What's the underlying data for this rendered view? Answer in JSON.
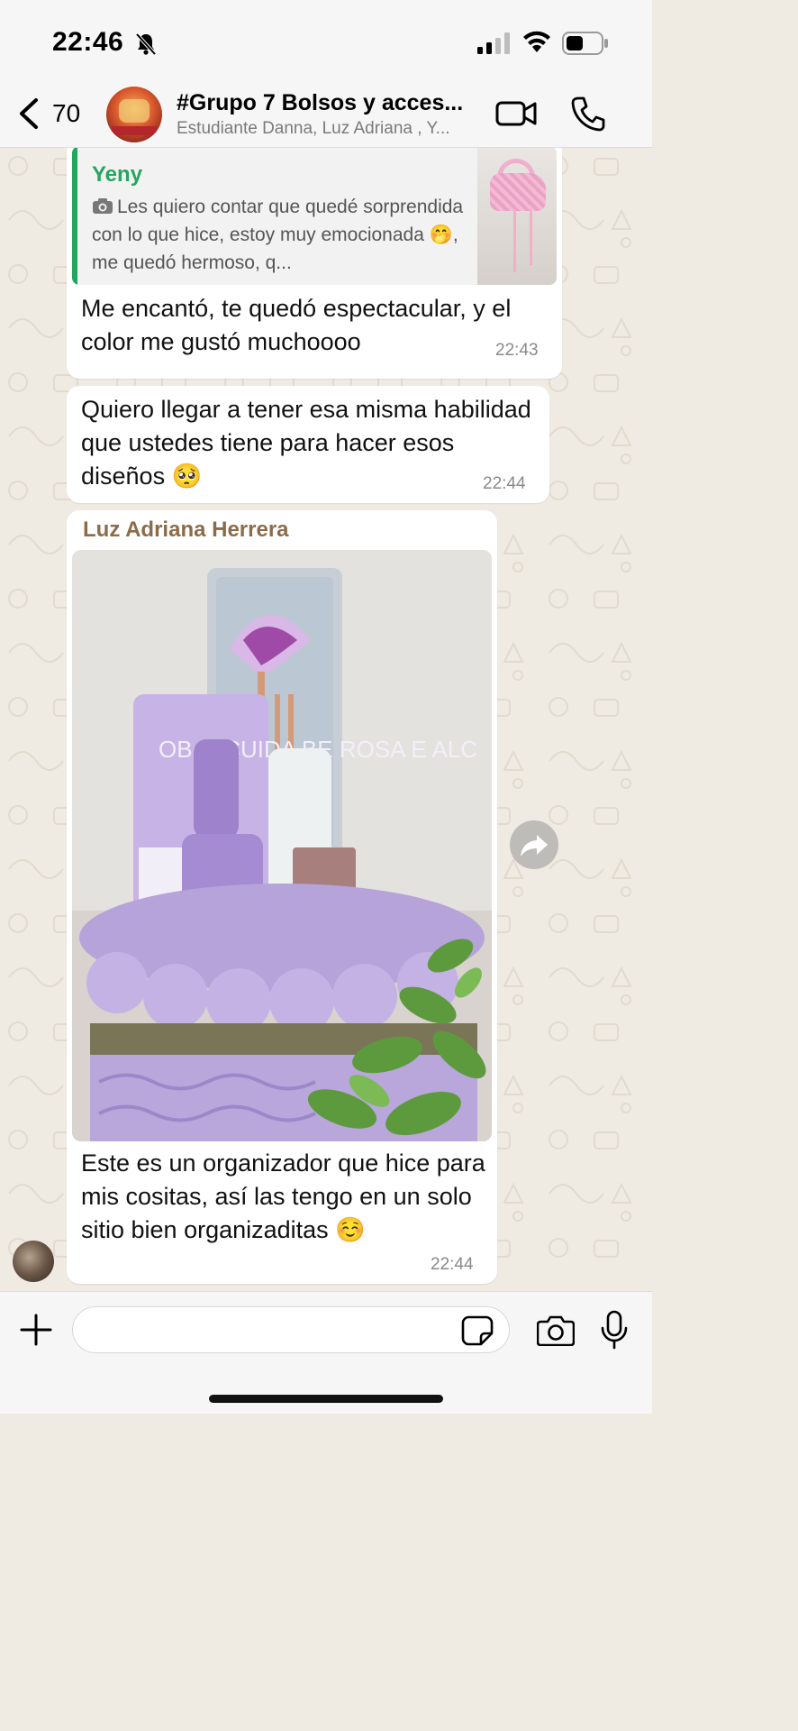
{
  "status_bar": {
    "time": "22:46"
  },
  "header": {
    "back_count": "70",
    "title": "#Grupo 7 Bolsos y acces...",
    "subtitle": "Estudiante Danna, Luz Adriana , Y..."
  },
  "messages": [
    {
      "quote": {
        "name": "Yeny",
        "text": "Les quiero contar que quedé sorprendida con lo que hice, estoy muy emocionada 🤭, me quedó hermoso, q..."
      },
      "text": "Me encantó, te quedó espectacular, y el color me gustó muchoooo",
      "time": "22:43"
    },
    {
      "text": "Quiero llegar a tener esa misma habilidad que ustedes tiene para hacer esos diseños 🥺",
      "time": "22:44"
    },
    {
      "sender": "Luz Adriana  Herrera",
      "photo_label": "OBoti CUIDA BE ROSA E ALC",
      "text": "Este es un organizador que hice para mis cositas, así las tengo en un solo sitio bien organizaditas ☺️",
      "time": "22:44"
    }
  ],
  "input": {
    "value": "",
    "placeholder": ""
  },
  "colors": {
    "accent_green": "#25a55f",
    "sender_brown": "#8b6b4a",
    "chat_bg": "#efeae2"
  }
}
